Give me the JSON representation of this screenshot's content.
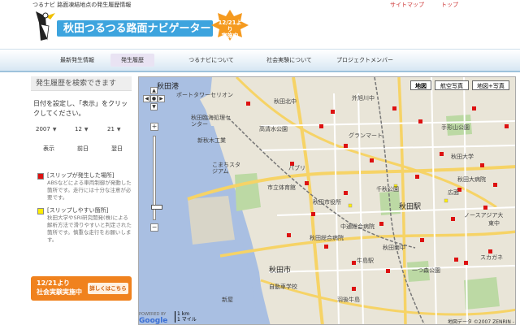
{
  "header": {
    "description": "つるナビ 路面凍結地点の発生履歴情報",
    "sitemap": "サイトマップ",
    "home": "トップ",
    "title": "秋田つるつる路面ナビゲーター",
    "burst_line1": "12/21より",
    "burst_line2": "実施中"
  },
  "nav": {
    "items": [
      {
        "label": "最新発生情報"
      },
      {
        "label": "発生履歴"
      },
      {
        "label": "つるナビについて"
      },
      {
        "label": "社会実験について"
      },
      {
        "label": "プロジェクトメンバー"
      }
    ]
  },
  "sidebar": {
    "heading": "発生履歴を検索できます",
    "instruction": "日付を設定し、「表示」をクリックしてください。",
    "year": "2007",
    "month": "12",
    "day": "21",
    "btn_show": "表示",
    "btn_prev": "前日",
    "btn_next": "翌日",
    "legend": [
      {
        "title": "[スリップが発生した場所]",
        "desc": "ABSなどによる車両制御が発動した箇所です。走行には十分な注意が必要です。",
        "color": "#dd1111"
      },
      {
        "title": "[スリップしやすい箇所]",
        "desc": "秋田大学やSRI研究開発(株)による解析方法で滑りやすいと判定された箇所です。慎重な走行をお願いします。",
        "color": "#ffee00"
      }
    ],
    "banner_line1": "12/21より",
    "banner_line2": "社会実験実施中",
    "banner_detail": "詳しくはこちら"
  },
  "map": {
    "btn_map": "地図",
    "btn_satellite": "航空写真",
    "btn_hybrid": "地図+写真",
    "labels": [
      "秋田港",
      "ポートタワーセリオン",
      "秋田臨海処理センター",
      "新秋木工業",
      "こまちスタジアム",
      "市立体育館",
      "秋田市役所",
      "高清水公園",
      "グランマート",
      "秋田駅",
      "秋田大学",
      "手形山公園",
      "千秋公園",
      "秋田南中",
      "牛島駅",
      "スカガネ",
      "ノースアジア大",
      "外旭川中",
      "秋田大病院",
      "秋田北中",
      "広面",
      "東中",
      "パブリ",
      "秋田市",
      "中通総合病院",
      "新屋",
      "自動車学校",
      "秋田総合病院",
      "羽後牛島",
      "一つ森公園"
    ],
    "scale_km": "1 km",
    "scale_mile": "1 マイル",
    "google": "Google",
    "powered": "POWERED BY",
    "attribution": "地図データ ©2007 ZENRIN - 利用規約"
  },
  "colors": {
    "accent": "#3da4de",
    "banner": "#f0821e",
    "slip": "#dd1111",
    "slippery": "#ffee00"
  }
}
